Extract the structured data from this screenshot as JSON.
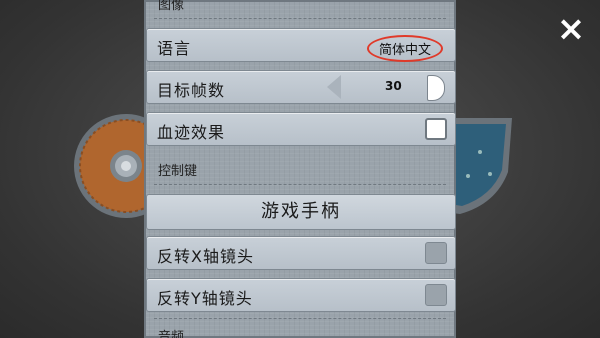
{
  "close_icon": "×",
  "menu": {
    "section_image": "图像",
    "language_label": "语言",
    "language_value": "简体中文",
    "fps_label": "目标帧数",
    "fps_value": "30",
    "blood_label": "血迹效果",
    "section_controls": "控制键",
    "gamepad_button": "游戏手柄",
    "invert_x_label": "反转X轴镜头",
    "invert_y_label": "反转Y轴镜头",
    "section_audio": "音频"
  },
  "colors": {
    "highlight_circle": "#e03a2a",
    "panel": "#9aa3ab"
  }
}
